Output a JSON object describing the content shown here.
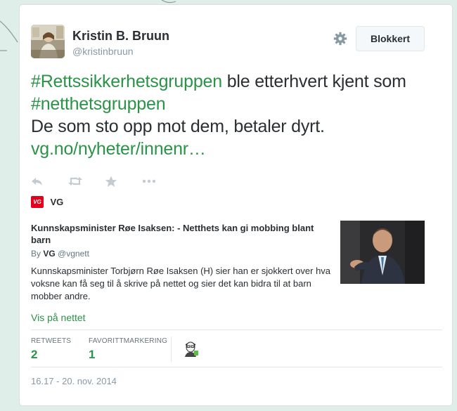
{
  "tweet": {
    "author_name": "Kristin B. Bruun",
    "author_handle": "@kristinbruun",
    "follow_button_label": "Blokkert",
    "text_hashtag_1": "#Rettssikkerhetsgruppen",
    "text_part_1": " ble etterhvert kjent som ",
    "text_hashtag_2": "#netthetsgruppen",
    "text_line_2": "De som sto opp mot dem,  betaler dyrt.",
    "text_link": "vg.no/nyheter/innenr…",
    "timestamp": "16.17 - 20. nov. 2014"
  },
  "actions": {
    "reply_icon": "reply-icon",
    "retweet_icon": "retweet-icon",
    "favorite_icon": "star-icon",
    "more_icon": "more-icon"
  },
  "card": {
    "source_logo_text": "VG",
    "source_name": "VG",
    "title": "Kunnskapsminister Røe Isaksen: - Netthets kan gi mobbing blant barn",
    "byline_prefix": "By",
    "byline_name": "VG",
    "byline_handle": "@vgnett",
    "description": "Kunnskapsminister Torbjørn Røe Isaksen (H) sier han er sjokkert over hva voksne kan få seg til å skrive på nettet og sier det kan bidra til at barn mobber andre.",
    "view_link": "Vis på nettet"
  },
  "stats": {
    "retweets_label": "RETWEETS",
    "retweets_value": "2",
    "favorites_label": "FAVORITTMARKERING",
    "favorites_value": "1"
  },
  "colors": {
    "accent": "#2a9348",
    "text": "#292f33",
    "muted": "#8899a6",
    "background": "#dfeee9",
    "vg_red": "#e2001a"
  }
}
